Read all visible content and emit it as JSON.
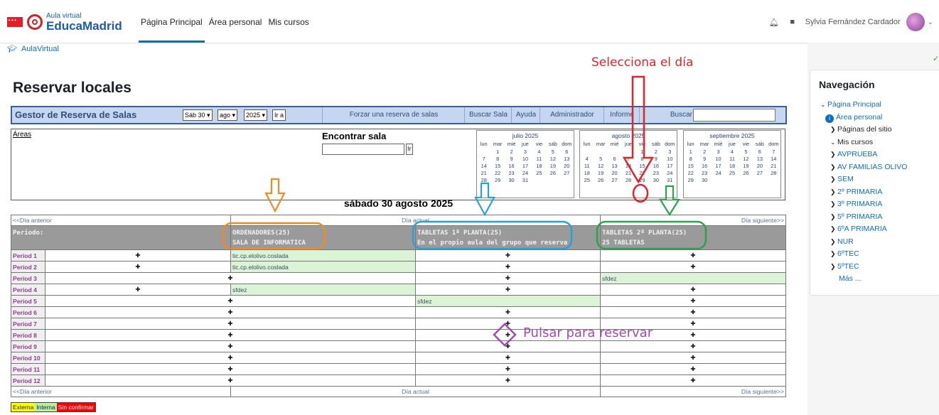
{
  "navbar": {
    "logo_small": "Aula virtual",
    "logo_big": "EducaMadrid",
    "items": [
      "Página Principal",
      "Área personal",
      "Mis cursos"
    ],
    "user_name": "Sylvia Fernández Cardador",
    "icons": [
      "bell-icon",
      "chat-icon"
    ]
  },
  "breadcrumb": {
    "label": "AulaVirtual"
  },
  "page": {
    "title": "Reservar locales"
  },
  "gestor": {
    "title": "Gestor de Reserva de Salas",
    "day_select": "Sáb 30",
    "month_select": "ago",
    "year_select": "2025",
    "go_button": "Ir a",
    "links": [
      "Forzar una reserva de salas",
      "Buscar Sala",
      "Ayuda",
      "Administrador",
      "Informe",
      "Buscar"
    ]
  },
  "upper": {
    "areas_label": "Áreas",
    "find_label": "Encontrar sala",
    "find_button": "Ir"
  },
  "calendars": [
    {
      "title": "julio 2025",
      "weekdays": [
        "lun",
        "mar",
        "mié",
        "jue",
        "vie",
        "sáb",
        "dom"
      ],
      "days": [
        "",
        "1",
        "2",
        "3",
        "4",
        "5",
        "6",
        "7",
        "8",
        "9",
        "10",
        "11",
        "12",
        "13",
        "14",
        "15",
        "16",
        "17",
        "18",
        "19",
        "20",
        "21",
        "22",
        "23",
        "24",
        "25",
        "26",
        "27",
        "28",
        "29",
        "30",
        "31"
      ]
    },
    {
      "title": "agosto 2025",
      "weekdays": [
        "lun",
        "mar",
        "mié",
        "jue",
        "vie",
        "sáb",
        "dom"
      ],
      "days": [
        "",
        "",
        "",
        "",
        "1",
        "2",
        "3",
        "4",
        "5",
        "6",
        "7",
        "8",
        "9",
        "10",
        "11",
        "12",
        "13",
        "14",
        "15",
        "16",
        "17",
        "18",
        "19",
        "20",
        "21",
        "22",
        "23",
        "24",
        "25",
        "26",
        "27",
        "28",
        "29",
        "30",
        "31"
      ]
    },
    {
      "title": "septiembre 2025",
      "weekdays": [
        "lun",
        "mar",
        "mié",
        "jue",
        "vie",
        "sáb",
        "dom"
      ],
      "days": [
        "1",
        "2",
        "3",
        "4",
        "5",
        "6",
        "7",
        "8",
        "9",
        "10",
        "11",
        "12",
        "13",
        "14",
        "15",
        "16",
        "17",
        "18",
        "19",
        "20",
        "21",
        "22",
        "23",
        "24",
        "25",
        "26",
        "27",
        "28",
        "29",
        "30"
      ]
    }
  ],
  "day_title": "sábado 30 agosto 2025",
  "day_nav": {
    "prev": "<<Día anterior",
    "today": "Día actual",
    "next": "Día siguiente>>"
  },
  "rooms": {
    "period_header": "Periodo:",
    "list": [
      {
        "name": "ORDENADORES(25)",
        "desc": "SALA DE INFORMATICA"
      },
      {
        "name": "TABLETAS 1ª PLANTA(25)",
        "desc": "En el propio aula del grupo que reserva"
      },
      {
        "name": "TABLETAS 2ª PLANTA(25)",
        "desc": "25 TABLETAS"
      }
    ]
  },
  "periods": [
    {
      "label": "Period 1",
      "c": [
        "+",
        "",
        "+",
        "+"
      ]
    },
    {
      "label": "Period 2",
      "c": [
        "+",
        "",
        "+",
        "+"
      ]
    },
    {
      "label": "Period 3",
      "c": [
        "+",
        "+",
        "+",
        ""
      ]
    },
    {
      "label": "Period 4",
      "c": [
        "+",
        "",
        "+",
        "+"
      ]
    },
    {
      "label": "Period 5",
      "c": [
        "+",
        "+",
        "",
        "+"
      ]
    },
    {
      "label": "Period 6",
      "c": [
        "+",
        "+",
        "+",
        "+"
      ]
    },
    {
      "label": "Period 7",
      "c": [
        "+",
        "+",
        "+",
        "+"
      ]
    },
    {
      "label": "Period 8",
      "c": [
        "+",
        "+",
        "+",
        "+"
      ]
    },
    {
      "label": "Period 9",
      "c": [
        "+",
        "+",
        "+",
        "+"
      ]
    },
    {
      "label": "Period 10",
      "c": [
        "+",
        "+",
        "+",
        "+"
      ]
    },
    {
      "label": "Period 11",
      "c": [
        "+",
        "+",
        "+",
        "+"
      ]
    },
    {
      "label": "Period 12",
      "c": [
        "+",
        "+",
        "+",
        "+"
      ]
    }
  ],
  "bookings": {
    "p1_ordenadores": "tic.cp.elolivo.coslada",
    "p2_ordenadores": "tic.cp.elolivo.coslada",
    "p3_tabletas2": "sfdez",
    "p4_ordenadores": "sfdez",
    "p5_tabletas1": "sfdez"
  },
  "legend": [
    {
      "label": "Externa",
      "color": "#ffff00"
    },
    {
      "label": "Interna",
      "color": "#b7f0a5"
    },
    {
      "label": "Sin confirmar",
      "color": "#ff0000"
    }
  ],
  "annotations": {
    "select_day": "Selecciona el día",
    "press_to_book": "Pulsar para reservar",
    "colors": {
      "red": "#e2232a",
      "orange": "#f08a24",
      "blue": "#28a0dc",
      "green": "#2aa44a",
      "purple": "#a24ab0"
    }
  },
  "drawer": {
    "title": "Navegación",
    "items": [
      {
        "label": "Página Principal",
        "level": 1,
        "icon": "chevron-down-icon"
      },
      {
        "label": "Área personal",
        "level": 2,
        "icon": "info-icon"
      },
      {
        "label": "Páginas del sitio",
        "level": 3,
        "icon": "chevron-right-icon"
      },
      {
        "label": "Mis cursos",
        "level": 3,
        "icon": "chevron-down-icon"
      },
      {
        "label": "AVPRUEBA",
        "level": 4,
        "icon": "chevron-right-icon"
      },
      {
        "label": "AV FAMILIAS OLIVO",
        "level": 4,
        "icon": "chevron-right-icon"
      },
      {
        "label": "SEM",
        "level": 4,
        "icon": "chevron-right-icon"
      },
      {
        "label": "2º PRIMARIA",
        "level": 4,
        "icon": "chevron-right-icon"
      },
      {
        "label": "3º PRIMARIA",
        "level": 4,
        "icon": "chevron-right-icon"
      },
      {
        "label": "5º PRIMARIA",
        "level": 4,
        "icon": "chevron-right-icon"
      },
      {
        "label": "6ºA PRIMARIA",
        "level": 4,
        "icon": "chevron-right-icon"
      },
      {
        "label": "NUR",
        "level": 4,
        "icon": "chevron-right-icon"
      },
      {
        "label": "6ºTEC",
        "level": 4,
        "icon": "chevron-right-icon"
      },
      {
        "label": "5ºTEC",
        "level": 4,
        "icon": "chevron-right-icon"
      }
    ],
    "more": "Más ..."
  }
}
